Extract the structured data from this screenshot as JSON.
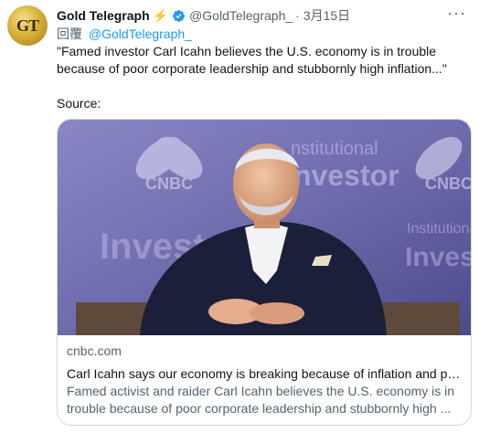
{
  "tweet": {
    "avatar_text": "GT",
    "display_name": "Gold Telegraph",
    "handle": "@GoldTelegraph_",
    "separator": "·",
    "date": "3月15日",
    "more": "···",
    "reply_prefix": "回覆",
    "reply_mention": "@GoldTelegraph_",
    "text_line": "\"Famed investor Carl Icahn believes the U.S. economy is in trouble because of poor corporate leadership and stubbornly high inflation...\"",
    "source_label": "Source:"
  },
  "card": {
    "backdrop_words": [
      "nstitutional",
      "nvestor",
      "Invest",
      "Institutional",
      "Inves"
    ],
    "logo_text": "CNBC",
    "domain": "cnbc.com",
    "headline": "Carl Icahn says our economy is breaking because of inflation and po...",
    "description": "Famed activist and raider Carl Icahn believes the U.S. economy is in trouble because of poor corporate leadership and stubbornly high ..."
  },
  "colors": {
    "accent": "#1d9bf0",
    "secondary_text": "#536471",
    "border": "#cfd9de",
    "photo_backdrop": "#6f6cae"
  },
  "icons": [
    "verified-badge-icon",
    "lightning-icon",
    "more-icon"
  ]
}
